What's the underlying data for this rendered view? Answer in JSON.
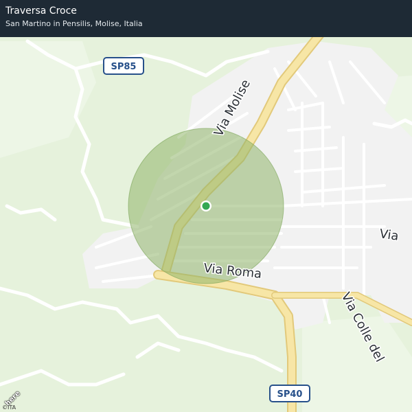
{
  "header": {
    "title": "Traversa Croce",
    "subtitle": "San Martino in Pensilis, Molise, Italia"
  },
  "map": {
    "streets": {
      "via_molise": "Via Molise",
      "via_roma": "Via Roma",
      "via_east": "Via",
      "via_colle": "Via Colle del"
    },
    "shields": {
      "sp85": "SP85",
      "sp40": "SP40"
    },
    "colors": {
      "land": "#e6f2dc",
      "urban": "#f2f2f2",
      "major_road": "#f7e6a6",
      "major_road_casing": "#e2c97a",
      "minor_road": "#ffffff",
      "location_circle": "#9ec07a",
      "location_dot": "#34a853",
      "header_bg": "#1e2a35"
    },
    "location_marker": "location-dot-icon"
  },
  "attribution": {
    "copyright": "©ITA",
    "logo": "here"
  }
}
